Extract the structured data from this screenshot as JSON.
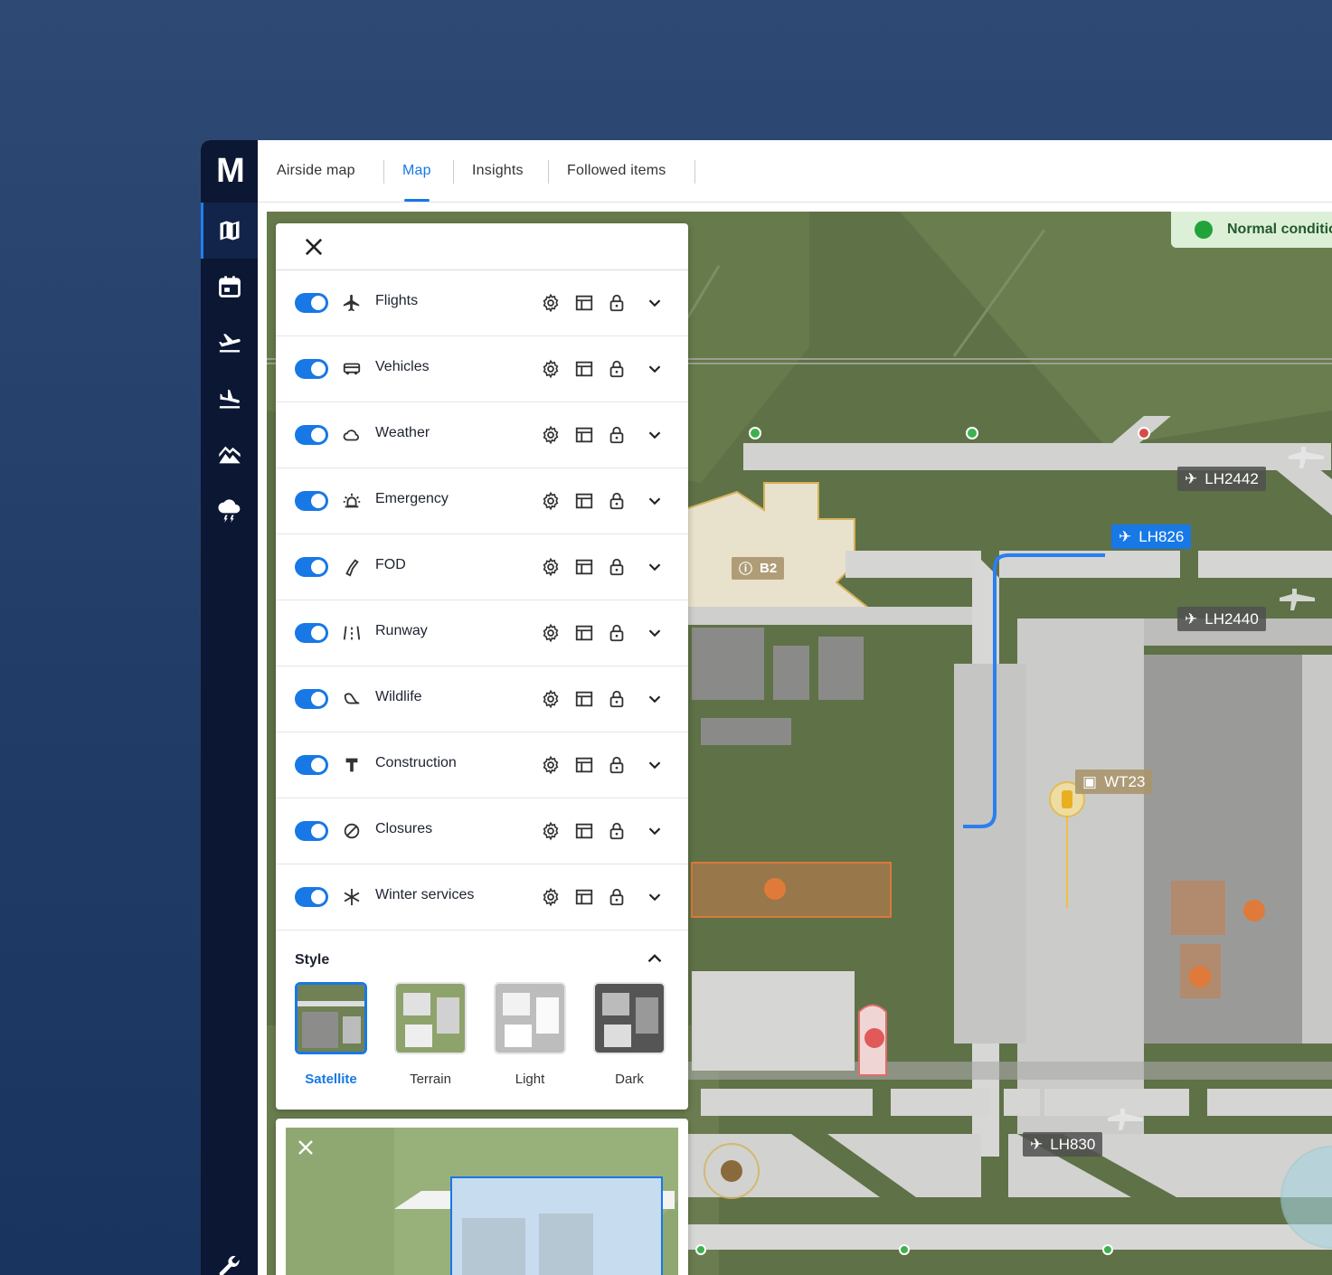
{
  "app": {
    "logo": "M"
  },
  "sidebar": {
    "items": [
      {
        "name": "map",
        "icon": "map-icon",
        "active": true
      },
      {
        "name": "calendar",
        "icon": "calendar-icon",
        "active": false
      },
      {
        "name": "departures",
        "icon": "flight-takeoff-icon",
        "active": false
      },
      {
        "name": "arrivals",
        "icon": "flight-land-icon",
        "active": false
      },
      {
        "name": "terrain",
        "icon": "terrain-icon",
        "active": false
      },
      {
        "name": "weather",
        "icon": "storm-cloud-icon",
        "active": false
      }
    ],
    "bottom_icon": "wrench-icon"
  },
  "tabs": [
    {
      "label": "Airside map",
      "active": false
    },
    {
      "label": "Map",
      "active": true
    },
    {
      "label": "Insights",
      "active": false
    },
    {
      "label": "Followed items",
      "active": false
    }
  ],
  "status": {
    "label": "Normal conditions",
    "color": "#22a33a"
  },
  "layers": [
    {
      "label": "Flights",
      "icon": "airplane-icon",
      "enabled": true
    },
    {
      "label": "Vehicles",
      "icon": "bus-icon",
      "enabled": true
    },
    {
      "label": "Weather",
      "icon": "cloud-icon",
      "enabled": true
    },
    {
      "label": "Emergency",
      "icon": "siren-icon",
      "enabled": true
    },
    {
      "label": "FOD",
      "icon": "fod-icon",
      "enabled": true
    },
    {
      "label": "Runway",
      "icon": "runway-icon",
      "enabled": true
    },
    {
      "label": "Wildlife",
      "icon": "bird-icon",
      "enabled": true
    },
    {
      "label": "Construction",
      "icon": "construction-icon",
      "enabled": true
    },
    {
      "label": "Closures",
      "icon": "closure-icon",
      "enabled": true
    },
    {
      "label": "Winter services",
      "icon": "snowflake-icon",
      "enabled": true
    }
  ],
  "style": {
    "title": "Style",
    "options": [
      {
        "label": "Satellite",
        "selected": true
      },
      {
        "label": "Terrain",
        "selected": false
      },
      {
        "label": "Light",
        "selected": false
      },
      {
        "label": "Dark",
        "selected": false
      }
    ]
  },
  "map_labels": {
    "lh2442": "LH2442",
    "lh826": "LH826",
    "lh2440": "LH2440",
    "lh830": "LH830",
    "wt23": "WT23",
    "b2": "B2"
  },
  "colors": {
    "accent": "#1778e6",
    "sidebar": "#0b1733"
  }
}
